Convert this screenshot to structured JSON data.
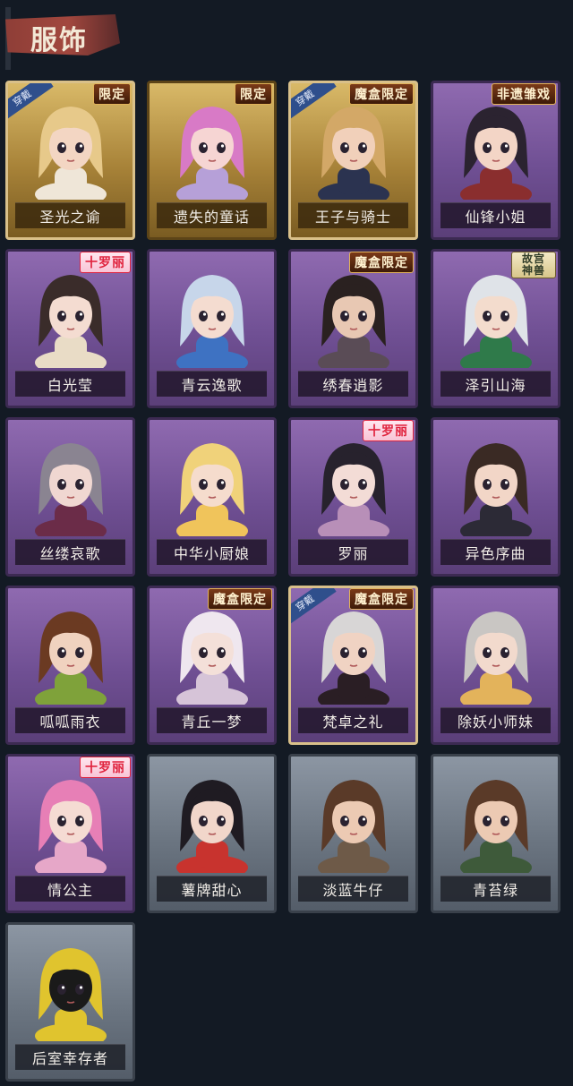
{
  "header": {
    "title": "服饰"
  },
  "ribbon_text": "穿戴",
  "skins": [
    {
      "name": "圣光之谕",
      "theme": "gold",
      "tag": "限定",
      "tag_style": "dark",
      "equipped": true,
      "hair": "#e7c98a",
      "skin": "#f3d6c3",
      "cloth": "#efe6d8"
    },
    {
      "name": "遗失的童话",
      "theme": "gold",
      "tag": "限定",
      "tag_style": "dark",
      "equipped": false,
      "hair": "#d87ac6",
      "skin": "#f6d5d3",
      "cloth": "#b6a0d8"
    },
    {
      "name": "王子与骑士",
      "theme": "gold",
      "tag": "魔盒限定",
      "tag_style": "dark",
      "equipped": true,
      "hair": "#d3a867",
      "skin": "#f1d0ba",
      "cloth": "#2b3350"
    },
    {
      "name": "仙锋小姐",
      "theme": "purple",
      "tag": "非遗雏戏",
      "tag_style": "dark",
      "equipped": false,
      "hair": "#2b2330",
      "skin": "#f3d5c6",
      "cloth": "#8a2e2e"
    },
    {
      "name": "白光莹",
      "theme": "purple",
      "tag": "十罗丽",
      "tag_style": "pink",
      "equipped": false,
      "hair": "#3a2c2a",
      "skin": "#f4dcd1",
      "cloth": "#e9dcc6"
    },
    {
      "name": "青云逸歌",
      "theme": "purple",
      "tag": "",
      "tag_style": "",
      "equipped": false,
      "hair": "#c7d6ea",
      "skin": "#f4dcd0",
      "cloth": "#3e72c2"
    },
    {
      "name": "绣春逍影",
      "theme": "purple",
      "tag": "魔盒限定",
      "tag_style": "dark",
      "equipped": false,
      "hair": "#2a2120",
      "skin": "#e8c8b3",
      "cloth": "#5a4c56"
    },
    {
      "name": "泽引山海",
      "theme": "purple",
      "tag": "故宫神兽",
      "tag_style": "green",
      "equipped": false,
      "hair": "#dfe3e8",
      "skin": "#f3dccd",
      "cloth": "#2f7a4a"
    },
    {
      "name": "丝缕哀歌",
      "theme": "purple",
      "tag": "",
      "tag_style": "",
      "equipped": false,
      "hair": "#8a8491",
      "skin": "#f0d7d1",
      "cloth": "#6b2c48"
    },
    {
      "name": "中华小厨娘",
      "theme": "purple",
      "tag": "",
      "tag_style": "",
      "equipped": false,
      "hair": "#f0d27a",
      "skin": "#f5dccd",
      "cloth": "#f0c45b"
    },
    {
      "name": "罗丽",
      "theme": "purple",
      "tag": "十罗丽",
      "tag_style": "pink",
      "equipped": false,
      "hair": "#27222d",
      "skin": "#f3dcd6",
      "cloth": "#b88fb8"
    },
    {
      "name": "异色序曲",
      "theme": "purple",
      "tag": "",
      "tag_style": "",
      "equipped": false,
      "hair": "#3a2a24",
      "skin": "#f2d6c7",
      "cloth": "#2c2a36"
    },
    {
      "name": "呱呱雨衣",
      "theme": "purple",
      "tag": "",
      "tag_style": "",
      "equipped": false,
      "hair": "#6b3a22",
      "skin": "#f0d2bf",
      "cloth": "#7fa23a"
    },
    {
      "name": "青丘一梦",
      "theme": "purple",
      "tag": "魔盒限定",
      "tag_style": "dark",
      "equipped": false,
      "hair": "#efe7ef",
      "skin": "#f4e0d9",
      "cloth": "#d6c4d8"
    },
    {
      "name": "梵卓之礼",
      "theme": "purple",
      "tag": "魔盒限定",
      "tag_style": "dark",
      "equipped": true,
      "hair": "#d8d6d6",
      "skin": "#f0d3c3",
      "cloth": "#2a1e24"
    },
    {
      "name": "除妖小师妹",
      "theme": "purple",
      "tag": "",
      "tag_style": "",
      "equipped": false,
      "hair": "#c9c6c3",
      "skin": "#f2dacd",
      "cloth": "#e3b35b"
    },
    {
      "name": "情公主",
      "theme": "purple",
      "tag": "十罗丽",
      "tag_style": "pink",
      "equipped": false,
      "hair": "#e77fb6",
      "skin": "#f5dbd3",
      "cloth": "#e6a7c8"
    },
    {
      "name": "薯牌甜心",
      "theme": "gray",
      "tag": "",
      "tag_style": "",
      "equipped": false,
      "hair": "#1f1b22",
      "skin": "#f1d6ca",
      "cloth": "#c8332e"
    },
    {
      "name": "淡蓝牛仔",
      "theme": "gray",
      "tag": "",
      "tag_style": "",
      "equipped": false,
      "hair": "#5a3a28",
      "skin": "#eccab3",
      "cloth": "#6e5a48"
    },
    {
      "name": "青苔绿",
      "theme": "gray",
      "tag": "",
      "tag_style": "",
      "equipped": false,
      "hair": "#5a3a28",
      "skin": "#eccab3",
      "cloth": "#3e5a3a"
    },
    {
      "name": "后室幸存者",
      "theme": "gray",
      "tag": "",
      "tag_style": "",
      "equipped": false,
      "hair": "#e0c42e",
      "skin": "#1a1a1a",
      "cloth": "#e0c42e"
    }
  ]
}
